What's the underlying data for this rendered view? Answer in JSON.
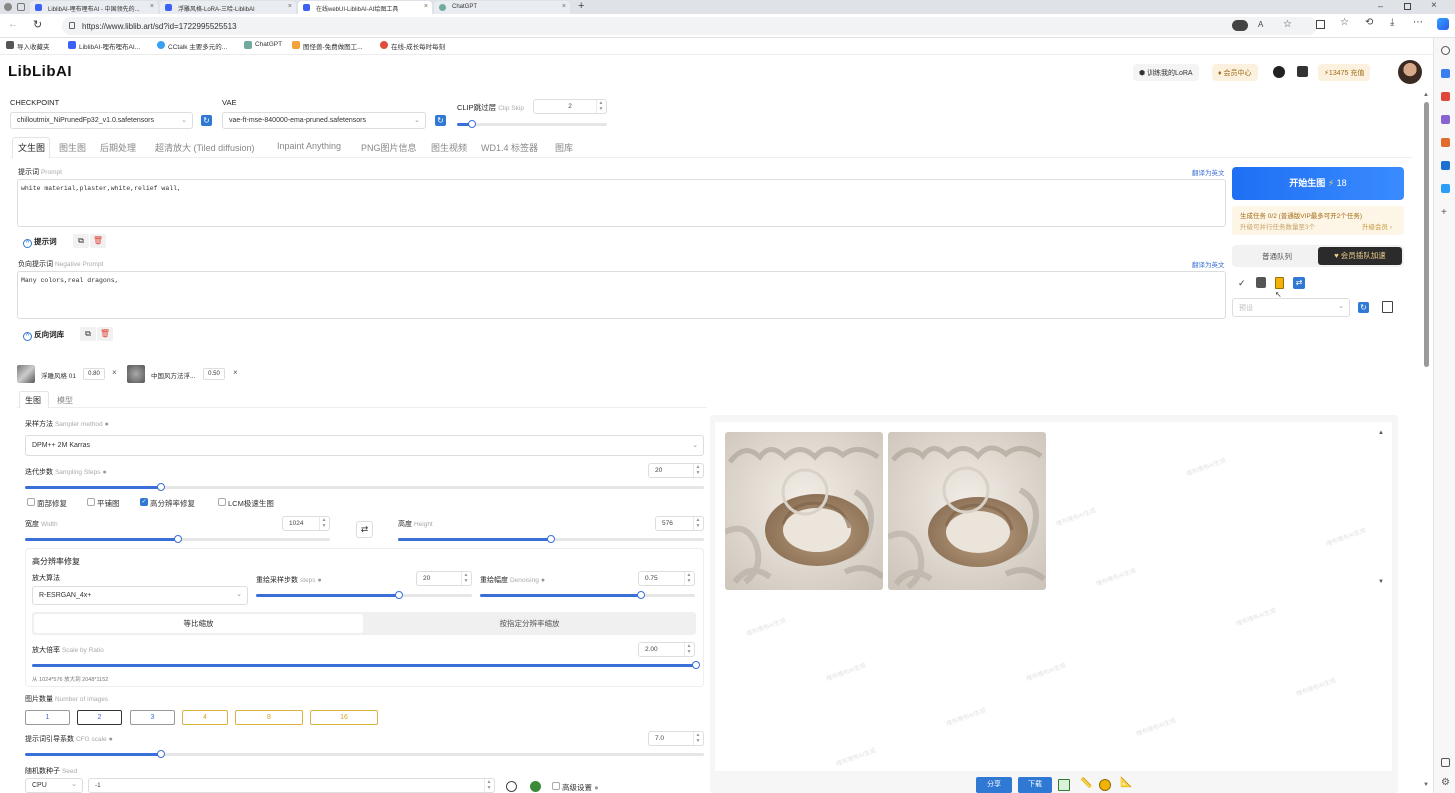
{
  "browser": {
    "tabs": [
      {
        "title": "LiblibAI-哩布哩布AI - 中国领先的..."
      },
      {
        "title": "浮雕风格-LoRA-三哈-LiblibAI"
      },
      {
        "title": "在线webUI-LiblibAI-AI绘图工具"
      },
      {
        "title": "ChatGPT"
      }
    ],
    "url": "https://www.liblib.art/sd?id=1722995525513",
    "bookmarks": [
      {
        "label": "导入收藏夹",
        "color": "#555555"
      },
      {
        "label": "LiblibAI-哩布哩布AI...",
        "color": "#3a63f3"
      },
      {
        "label": "CCtalk 主要多元的...",
        "color": "#3aa0f3"
      },
      {
        "label": "ChatGPT",
        "color": "#74aa9c"
      },
      {
        "label": "图怪兽-免费做图工...",
        "color": "#f3a23a"
      },
      {
        "label": "在线-成长每时每刻",
        "color": "#e04d3a"
      }
    ]
  },
  "app": {
    "logo": "LibLibAI",
    "header": {
      "train_lora": "训练我的LoRA",
      "member": "会员中心",
      "points": "13475",
      "recharge": "充值"
    }
  },
  "settings": {
    "checkpoint_label": "CHECKPOINT",
    "checkpoint_value": "chilloutmix_NiPrunedFp32_v1.0.safetensors",
    "vae_label": "VAE",
    "vae_value": "vae-ft-mse-840000-ema-pruned.safetensors",
    "clip_label": "CLIP跳过层",
    "clip_hint": "Clip Skip",
    "clip_value": "2",
    "clip_fraction": 0.1
  },
  "tabs": [
    "文生图",
    "图生图",
    "后期处理",
    "超清放大 (Tiled diffusion)",
    "Inpaint Anything",
    "PNG图片信息",
    "图生视频",
    "WD1.4 标签器",
    "图库"
  ],
  "prompt": {
    "label": "提示词",
    "hint": "Prompt",
    "value": "white material,plaster,white,relief wall,",
    "translate": "翻译为英文",
    "lib_label": "提示词"
  },
  "negative": {
    "label": "负向提示词",
    "hint": "Negative Prompt",
    "value": "Many colors,real dragons,",
    "translate": "翻译为英文",
    "lib_label": "反向词库"
  },
  "generate": {
    "button": "开始生图",
    "cost": "18",
    "task_info": "生成任务 0/2 (普通版VIP最多可开2个任务)",
    "upgrade_info": "升级可并行任务数量至3个",
    "upgrade_link": "升级会员 ›",
    "queue_normal": "普通队列",
    "queue_vip": "会员插队加速",
    "preset_placeholder": "预设"
  },
  "loras": [
    {
      "name": "浮雕风格 01",
      "weight": "0.80"
    },
    {
      "name": "中国风方法浮...",
      "weight": "0.50"
    }
  ],
  "subtabs": [
    "生图",
    "模型"
  ],
  "sampler": {
    "label": "采样方法",
    "hint": "Sampler method",
    "value": "DPM++ 2M Karras"
  },
  "steps": {
    "label": "迭代步数",
    "hint": "Sampling Steps",
    "value": "20",
    "fraction": 0.2
  },
  "options": [
    {
      "label": "面部修复",
      "checked": false
    },
    {
      "label": "平铺图",
      "checked": false
    },
    {
      "label": "高分辨率修复",
      "checked": true
    },
    {
      "label": "LCM极速生图",
      "checked": false
    }
  ],
  "width": {
    "label": "宽度",
    "hint": "Width",
    "value": "1024",
    "fraction": 0.5
  },
  "height": {
    "label": "高度",
    "hint": "Height",
    "value": "576",
    "fraction": 0.5
  },
  "hires": {
    "title": "高分辨率修复",
    "upscaler_label": "放大算法",
    "upscaler_value": "R-ESRGAN_4x+",
    "steps_label": "重绘采样步数",
    "steps_hint": "steps",
    "steps_value": "20",
    "steps_fraction": 0.66,
    "denoise_label": "重绘幅度",
    "denoise_hint": "Denoising",
    "denoise_value": "0.75",
    "denoise_fraction": 0.75,
    "mode_ratio": "等比缩放",
    "mode_resolution": "按指定分辨率缩放",
    "scale_label": "放大倍率",
    "scale_hint": "Scale by Ratio",
    "scale_value": "2.00",
    "scale_fraction": 1.0,
    "size_note": "从 1024*576 放大到 2048*1152"
  },
  "batch": {
    "label": "图片数量",
    "hint": "Number of images",
    "counts": [
      "1",
      "2",
      "3",
      "4",
      "8",
      "16"
    ],
    "selected": "2"
  },
  "cfg": {
    "label": "提示词引导系数",
    "hint": "CFG scale",
    "value": "7.0",
    "fraction": 0.2
  },
  "seed": {
    "label": "随机数种子",
    "hint": "Seed",
    "device": "CPU",
    "value": "-1",
    "advanced": "高级设置"
  },
  "output": {
    "watermark": "哩布哩布AI生成",
    "share": "分享",
    "download": "下载"
  }
}
